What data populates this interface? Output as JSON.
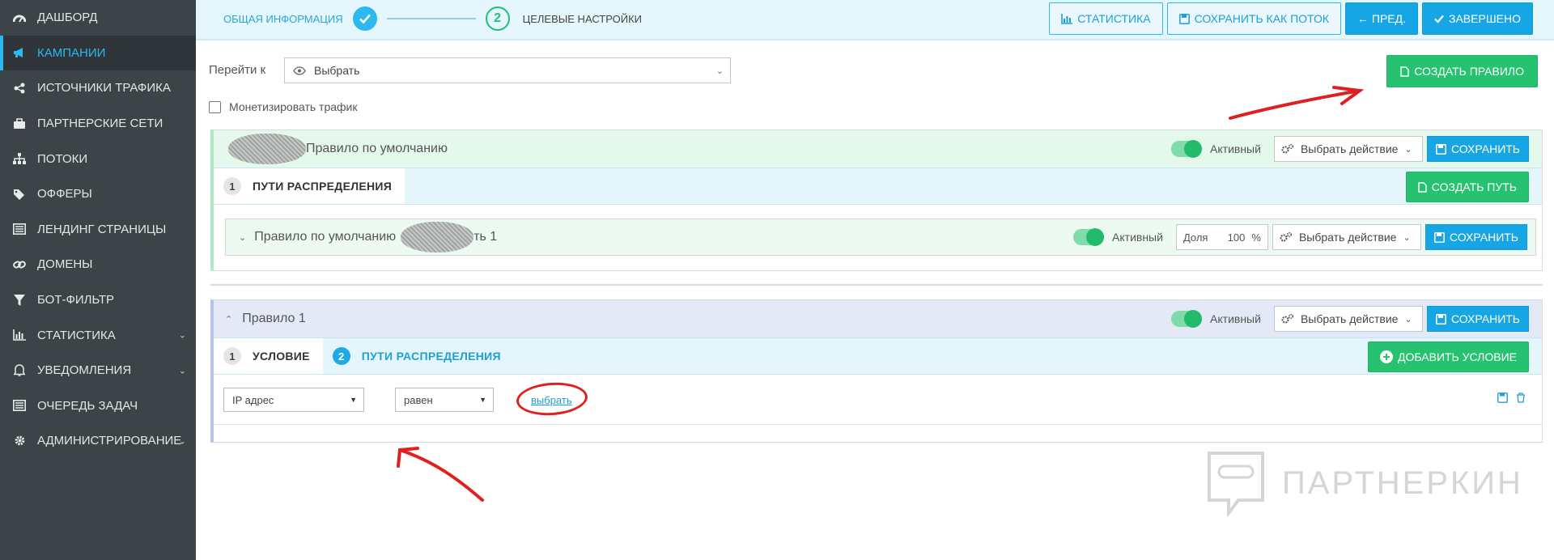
{
  "sidebar": {
    "items": [
      {
        "label": "Дашборд",
        "icon": "dashboard-icon"
      },
      {
        "label": "Кампании",
        "icon": "megaphone-icon",
        "active": true
      },
      {
        "label": "Источники трафика",
        "icon": "share-icon"
      },
      {
        "label": "Партнерские сети",
        "icon": "briefcase-icon"
      },
      {
        "label": "Потоки",
        "icon": "sitemap-icon"
      },
      {
        "label": "Офферы",
        "icon": "tags-icon"
      },
      {
        "label": "Лендинг страницы",
        "icon": "list-icon"
      },
      {
        "label": "Домены",
        "icon": "link-icon"
      },
      {
        "label": "Бот-фильтр",
        "icon": "filter-icon"
      },
      {
        "label": "Статистика",
        "icon": "bar-chart-icon",
        "expandable": true
      },
      {
        "label": "Уведомления",
        "icon": "bell-icon",
        "expandable": true
      },
      {
        "label": "Очередь задач",
        "icon": "queue-icon"
      },
      {
        "label": "Администрирование",
        "icon": "gear-icon",
        "expandable": true
      }
    ],
    "colors": {
      "bg": "#3d4448",
      "accent": "#2db8f0"
    }
  },
  "wizard": {
    "step1_label": "Общая информация",
    "step2_number": "2",
    "step2_label": "Целевые настройки"
  },
  "toolbar": {
    "stats_label": "Статистика",
    "save_as_flow_label": "Сохранить как поток",
    "prev_label": "← Пред.",
    "finish_label": "Завершено"
  },
  "goto": {
    "label": "Перейти к",
    "select_value": "Выбрать"
  },
  "create_rule_label": "Создать правило",
  "monetize_label": "Монетизировать трафик",
  "rule_default": {
    "title": "Правило по умолчанию",
    "status": "Активный",
    "action_placeholder": "Выбрать действие",
    "save_label": "Сохранить",
    "tab1_number": "1",
    "tab1_label": "Пути распределения",
    "create_path_label": "Создать путь",
    "path": {
      "title_start": "Правило по умолчанию",
      "title_end": "ть 1",
      "status": "Активный",
      "share_label": "Доля",
      "share_value": "100",
      "share_unit": "%",
      "action_placeholder": "Выбрать действие",
      "save_label": "Сохранить"
    }
  },
  "rule_1": {
    "title": "Правило 1",
    "status": "Активный",
    "action_placeholder": "Выбрать действие",
    "save_label": "Сохранить",
    "tab1_number": "1",
    "tab1_label": "Условие",
    "tab2_number": "2",
    "tab2_label": "Пути распределения",
    "add_condition_label": "Добавить условие",
    "condition": {
      "field_value": "IP адрес",
      "operator_value": "равен",
      "pick_link": "выбрать"
    }
  },
  "watermark": "ПАРТНЕРКИН",
  "colors": {
    "primary": "#16a6e6",
    "success": "#27c26f",
    "annotation": "#e02020"
  }
}
